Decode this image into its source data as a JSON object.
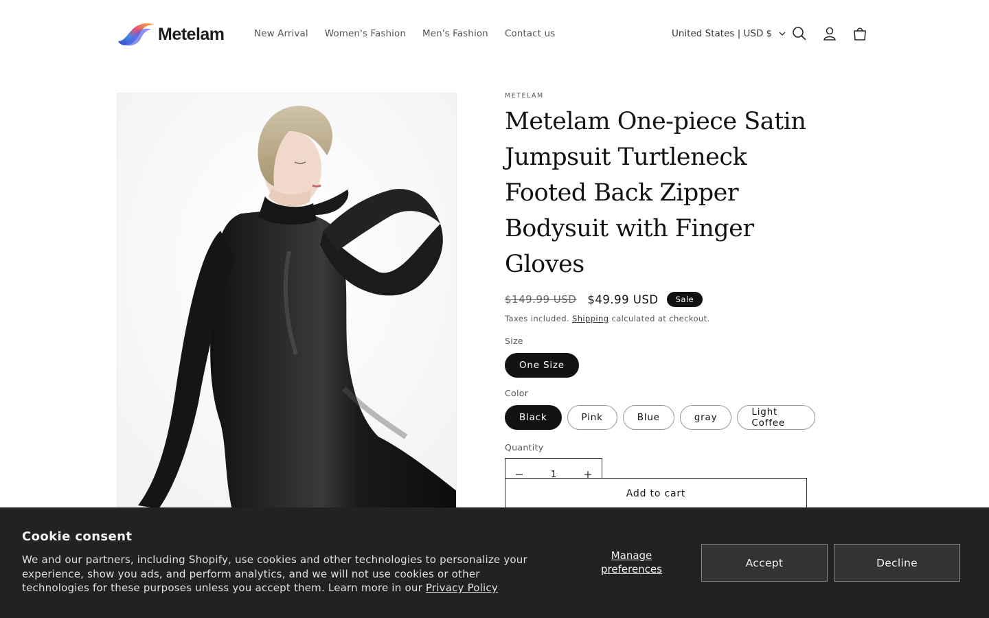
{
  "header": {
    "logo_text": "Metelam",
    "nav": [
      "New Arrival",
      "Women's Fashion",
      "Men's Fashion",
      "Contact us"
    ],
    "currency": "United States | USD $",
    "icons": [
      "search-icon",
      "account-icon",
      "cart-icon"
    ]
  },
  "product": {
    "vendor": "METELAM",
    "title": "Metelam One-piece Satin Jumpsuit Turtleneck Footed Back Zipper Bodysuit with Finger Gloves",
    "price_old": "$149.99 USD",
    "price_new": "$49.99 USD",
    "badge": "Sale",
    "tax_prefix": "Taxes included.",
    "tax_link": "Shipping",
    "tax_suffix": "calculated at checkout.",
    "size_label": "Size",
    "sizes": [
      "One Size"
    ],
    "selected_size": "One Size",
    "color_label": "Color",
    "colors": [
      "Black",
      "Pink",
      "Blue",
      "gray",
      "Light Coffee"
    ],
    "selected_color": "Black",
    "quantity_label": "Quantity",
    "quantity": "1",
    "add_to_cart": "Add to cart"
  },
  "cookie": {
    "title": "Cookie consent",
    "text": "We and our partners, including Shopify, use cookies and other technologies to personalize your experience, show you ads, and perform analytics, and we will not use cookies or other technologies for these purposes unless you accept them. Learn more in our",
    "link": "Privacy Policy",
    "manage": "Manage preferences",
    "accept": "Accept",
    "decline": "Decline"
  },
  "colors": {
    "text": "#121212",
    "banner_bg": "#222222",
    "button_bg": "#333333",
    "logo_gradient": [
      "#3b6fe0",
      "#e04a7a",
      "#f5b431"
    ]
  }
}
